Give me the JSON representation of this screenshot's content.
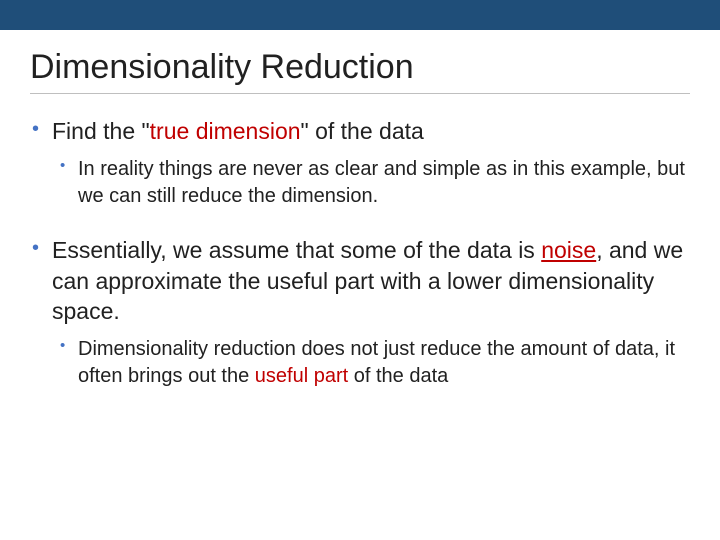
{
  "slide": {
    "title": "Dimensionality Reduction",
    "b1": {
      "pre": "Find the \"",
      "hl": "true dimension",
      "post": "\" of the data",
      "sub": "In reality things are never as clear and simple as in this example, but we can still reduce the dimension."
    },
    "b2": {
      "pre": "Essentially, we assume that some of the data is ",
      "noise": "noise",
      "post": ", and we can approximate the useful part with a lower dimensionality space.",
      "sub_pre": "Dimensionality reduction does not just reduce the amount of data, it often brings out the ",
      "sub_hl": "useful part",
      "sub_post": " of the data"
    }
  }
}
